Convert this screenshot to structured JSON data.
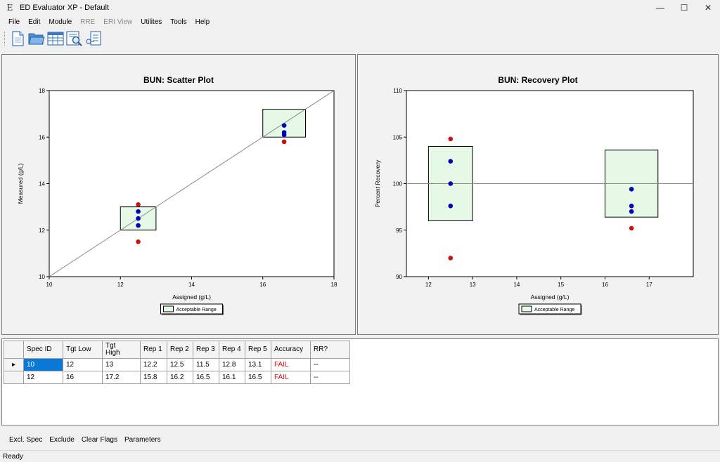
{
  "window": {
    "title": "ED Evaluator XP - Default",
    "icon_glyph": "E",
    "minimize": "—",
    "maximize": "☐",
    "close": "✕"
  },
  "menu": {
    "items": [
      {
        "label": "File",
        "enabled": true
      },
      {
        "label": "Edit",
        "enabled": true
      },
      {
        "label": "Module",
        "enabled": true
      },
      {
        "label": "RRE",
        "enabled": false
      },
      {
        "label": "ERI View",
        "enabled": false
      },
      {
        "label": "Utilites",
        "enabled": true
      },
      {
        "label": "Tools",
        "enabled": true
      },
      {
        "label": "Help",
        "enabled": true
      }
    ]
  },
  "toolbar": {
    "buttons": [
      "new-document-icon",
      "open-folder-icon",
      "table-icon",
      "report-preview-icon",
      "export-icon"
    ]
  },
  "colors": {
    "accent": "#0a78d7",
    "fail": "#d91010",
    "range_fill": "#e6f9e6",
    "point_blue": "#0000b8",
    "point_red": "#cc1010"
  },
  "chart_data": [
    {
      "type": "scatter",
      "title": "BUN: Scatter Plot",
      "xlabel": "Assigned (g/L)",
      "ylabel": "Measured (g/L)",
      "xlim": [
        10,
        18
      ],
      "ylim": [
        10,
        18
      ],
      "xticks": [
        10,
        12,
        14,
        16,
        18
      ],
      "yticks": [
        10,
        12,
        14,
        16,
        18
      ],
      "identity_line": true,
      "legend": {
        "label": "Acceptable Range",
        "position": "bottom-center"
      },
      "ranges": [
        {
          "x_low": 12,
          "x_high": 13,
          "y_low": 12,
          "y_high": 13
        },
        {
          "x_low": 16,
          "x_high": 17.2,
          "y_low": 16,
          "y_high": 17.2
        }
      ],
      "points": [
        {
          "x": 12.5,
          "y": 13.1,
          "flag": "red"
        },
        {
          "x": 12.5,
          "y": 12.8,
          "flag": "blue"
        },
        {
          "x": 12.5,
          "y": 12.5,
          "flag": "blue"
        },
        {
          "x": 12.5,
          "y": 12.2,
          "flag": "blue"
        },
        {
          "x": 12.5,
          "y": 11.5,
          "flag": "red"
        },
        {
          "x": 16.6,
          "y": 16.5,
          "flag": "blue"
        },
        {
          "x": 16.6,
          "y": 16.2,
          "flag": "blue"
        },
        {
          "x": 16.6,
          "y": 16.1,
          "flag": "blue"
        },
        {
          "x": 16.6,
          "y": 15.8,
          "flag": "red"
        }
      ]
    },
    {
      "type": "scatter",
      "title": "BUN: Recovery Plot",
      "xlabel": "Assigned (g/L)",
      "ylabel": "Percent Recovery",
      "xlim": [
        11.5,
        18
      ],
      "ylim": [
        90,
        110
      ],
      "xticks": [
        12,
        13,
        14,
        15,
        16,
        17
      ],
      "yticks": [
        90,
        95,
        100,
        105,
        110
      ],
      "reference_y": 100,
      "legend": {
        "label": "Acceptable Range",
        "position": "bottom-center"
      },
      "ranges": [
        {
          "x_low": 12,
          "x_high": 13,
          "y_low": 96,
          "y_high": 104
        },
        {
          "x_low": 16,
          "x_high": 17.2,
          "y_low": 96.4,
          "y_high": 103.6
        }
      ],
      "points": [
        {
          "x": 12.5,
          "y": 104.8,
          "flag": "red"
        },
        {
          "x": 12.5,
          "y": 102.4,
          "flag": "blue"
        },
        {
          "x": 12.5,
          "y": 100,
          "flag": "blue"
        },
        {
          "x": 12.5,
          "y": 97.6,
          "flag": "blue"
        },
        {
          "x": 12.5,
          "y": 92,
          "flag": "red"
        },
        {
          "x": 16.6,
          "y": 99.4,
          "flag": "blue"
        },
        {
          "x": 16.6,
          "y": 97.6,
          "flag": "blue"
        },
        {
          "x": 16.6,
          "y": 97,
          "flag": "blue"
        },
        {
          "x": 16.6,
          "y": 95.2,
          "flag": "red"
        }
      ]
    }
  ],
  "grid": {
    "columns": [
      "Spec ID",
      "Tgt Low",
      "Tgt High",
      "Rep 1",
      "Rep 2",
      "Rep 3",
      "Rep 4",
      "Rep 5",
      "Accuracy",
      "RR?"
    ],
    "rows": [
      {
        "current": true,
        "cells": [
          "10",
          "12",
          "13",
          "12.2",
          "12.5",
          "11.5",
          "12.8",
          "13.1",
          "FAIL",
          "--"
        ]
      },
      {
        "current": false,
        "cells": [
          "12",
          "16",
          "17.2",
          "15.8",
          "16.2",
          "16.5",
          "16.1",
          "16.5",
          "FAIL",
          "--"
        ]
      }
    ],
    "row_marker": "▸"
  },
  "bottom_buttons": [
    "Excl. Spec",
    "Exclude",
    "Clear Flags",
    "Parameters"
  ],
  "status": "Ready"
}
